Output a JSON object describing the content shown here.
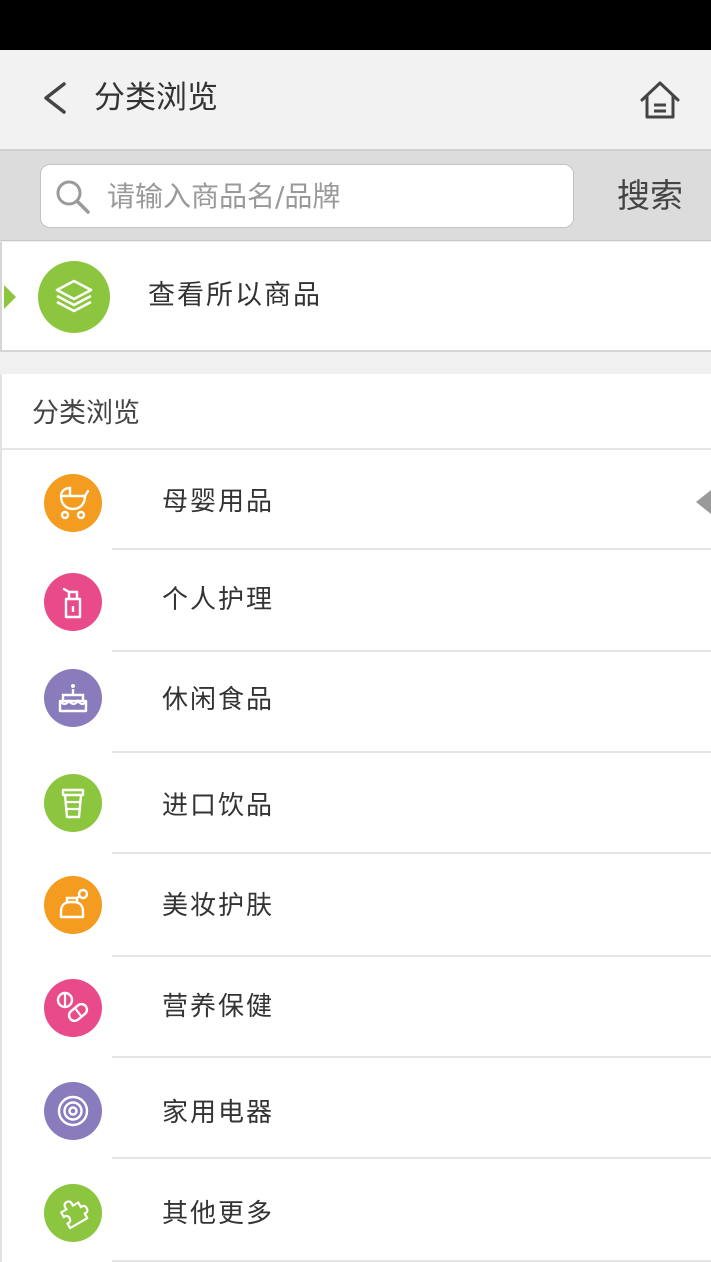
{
  "header": {
    "title": "分类浏览",
    "back_icon": "chevron-left-icon",
    "home_icon": "home-icon"
  },
  "search": {
    "placeholder": "请输入商品名/品牌",
    "value": "",
    "button_label": "搜索"
  },
  "all_products": {
    "label": "查看所以商品",
    "icon": "layers-icon",
    "color": "#8cc63f"
  },
  "category_section": {
    "title": "分类浏览",
    "selected_index": 0,
    "items": [
      {
        "label": "母婴用品",
        "icon": "stroller-icon",
        "color": "#f39c1f"
      },
      {
        "label": "个人护理",
        "icon": "bottle-icon",
        "color": "#e94b8a"
      },
      {
        "label": "休闲食品",
        "icon": "cake-icon",
        "color": "#8a7bbd"
      },
      {
        "label": "进口饮品",
        "icon": "cup-icon",
        "color": "#8cc63f"
      },
      {
        "label": "美妆护肤",
        "icon": "cosmetics-icon",
        "color": "#f39c1f"
      },
      {
        "label": "营养保健",
        "icon": "pill-icon",
        "color": "#e94b8a"
      },
      {
        "label": "家用电器",
        "icon": "appliance-icon",
        "color": "#8a7bbd"
      },
      {
        "label": "其他更多",
        "icon": "puzzle-icon",
        "color": "#8cc63f"
      }
    ]
  }
}
